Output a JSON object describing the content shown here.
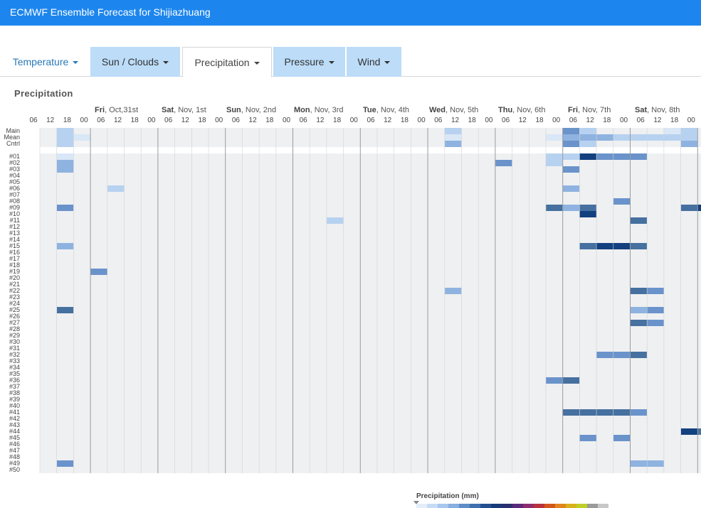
{
  "app": {
    "title": "ECMWF Ensemble Forecast for Shijiazhuang"
  },
  "tabs": [
    {
      "label": "Temperature",
      "active": false
    },
    {
      "label": "Sun / Clouds",
      "active": false
    },
    {
      "label": "Precipitation",
      "active": true
    },
    {
      "label": "Pressure",
      "active": false
    },
    {
      "label": "Wind",
      "active": false
    }
  ],
  "section": {
    "title": "Precipitation"
  },
  "days": [
    {
      "weekday": "Fri",
      "date": ", Oct,31st"
    },
    {
      "weekday": "Sat",
      "date": ", Nov, 1st"
    },
    {
      "weekday": "Sun",
      "date": ", Nov, 2nd"
    },
    {
      "weekday": "Mon",
      "date": ", Nov, 3rd"
    },
    {
      "weekday": "Tue",
      "date": ", Nov, 4th"
    },
    {
      "weekday": "Wed",
      "date": ", Nov, 5th"
    },
    {
      "weekday": "Thu",
      "date": ", Nov, 6th"
    },
    {
      "weekday": "Fri",
      "date": ", Nov, 7th"
    },
    {
      "weekday": "Sat",
      "date": ", Nov, 8th"
    }
  ],
  "hours": [
    "06",
    "12",
    "18",
    "00",
    "06",
    "12",
    "18",
    "00",
    "06",
    "12",
    "18",
    "00",
    "06",
    "12",
    "18",
    "00",
    "06",
    "12",
    "18",
    "00",
    "06",
    "12",
    "18",
    "00",
    "06",
    "12",
    "18",
    "00",
    "06",
    "12",
    "18",
    "00",
    "06",
    "12",
    "18",
    "00",
    "06",
    "12",
    "18",
    "00",
    "00"
  ],
  "summary_rows": [
    "Main",
    "Mean",
    "Cntrl"
  ],
  "members": [
    "#01",
    "#02",
    "#03",
    "#04",
    "#05",
    "#06",
    "#07",
    "#08",
    "#09",
    "#10",
    "#11",
    "#12",
    "#13",
    "#14",
    "#15",
    "#16",
    "#17",
    "#18",
    "#19",
    "#20",
    "#21",
    "#22",
    "#23",
    "#24",
    "#25",
    "#26",
    "#27",
    "#28",
    "#29",
    "#30",
    "#31",
    "#32",
    "#33",
    "#34",
    "#35",
    "#36",
    "#37",
    "#38",
    "#39",
    "#40",
    "#41",
    "#42",
    "#43",
    "#44",
    "#45",
    "#46",
    "#47",
    "#48",
    "#49",
    "#50"
  ],
  "legend": {
    "title": "Precipitation (mm)",
    "colors": [
      "#e4eefa",
      "#c6dcf6",
      "#a7c7ee",
      "#86aedf",
      "#5f8dc7",
      "#3f6fae",
      "#244f8f",
      "#163b78",
      "#2a2f6e",
      "#5a2a7a",
      "#8f2c6e",
      "#b8323c",
      "#d4561d",
      "#e1861d",
      "#d8b21c",
      "#bfcf27",
      "#9a9a9a",
      "#c8c8c8"
    ]
  },
  "colors": {
    "titlebar": "#1d86ee",
    "tab_inactive": "#bcdcf8",
    "precip_scale": [
      "#eff0f2",
      "#d9e7f7",
      "#b7d2f0",
      "#8fb3e0",
      "#6a93cb",
      "#46709f",
      "#13407f"
    ]
  },
  "chart_data": {
    "type": "heatmap",
    "title": "Precipitation",
    "xlabel": "",
    "ylabel": "",
    "x_days": [
      "Fri, Oct,31st",
      "Sat, Nov, 1st",
      "Sun, Nov, 2nd",
      "Mon, Nov, 3rd",
      "Tue, Nov, 4th",
      "Wed, Nov, 5th",
      "Thu, Nov, 6th",
      "Fri, Nov, 7th",
      "Sat, Nov, 8th"
    ],
    "x_hours": [
      "06",
      "12",
      "18",
      "00"
    ],
    "rows": [
      "Main",
      "Mean",
      "Cntrl",
      "#01",
      "#02",
      "#03",
      "#04",
      "#05",
      "#06",
      "#07",
      "#08",
      "#09",
      "#10",
      "#11",
      "#12",
      "#13",
      "#14",
      "#15",
      "#16",
      "#17",
      "#18",
      "#19",
      "#20",
      "#21",
      "#22",
      "#23",
      "#24",
      "#25",
      "#26",
      "#27",
      "#28",
      "#29",
      "#30",
      "#31",
      "#32",
      "#33",
      "#34",
      "#35",
      "#36",
      "#37",
      "#38",
      "#39",
      "#40",
      "#41",
      "#42",
      "#43",
      "#44",
      "#45",
      "#46",
      "#47",
      "#48",
      "#49",
      "#50"
    ],
    "intensity_levels": "0 = none, 1 = very light ... 6 = heavy",
    "cells": [
      {
        "row": "Main",
        "col": 1,
        "v": 2
      },
      {
        "row": "Main",
        "col": 24,
        "v": 2
      },
      {
        "row": "Main",
        "col": 31,
        "v": 4
      },
      {
        "row": "Main",
        "col": 32,
        "v": 2
      },
      {
        "row": "Main",
        "col": 37,
        "v": 1
      },
      {
        "row": "Main",
        "col": 38,
        "v": 2
      },
      {
        "row": "Mean",
        "col": 1,
        "v": 2
      },
      {
        "row": "Mean",
        "col": 2,
        "v": 1
      },
      {
        "row": "Mean",
        "col": 24,
        "v": 1
      },
      {
        "row": "Mean",
        "col": 30,
        "v": 1
      },
      {
        "row": "Mean",
        "col": 31,
        "v": 3
      },
      {
        "row": "Mean",
        "col": 32,
        "v": 3
      },
      {
        "row": "Mean",
        "col": 33,
        "v": 3
      },
      {
        "row": "Mean",
        "col": 34,
        "v": 2
      },
      {
        "row": "Mean",
        "col": 35,
        "v": 2
      },
      {
        "row": "Mean",
        "col": 36,
        "v": 2
      },
      {
        "row": "Mean",
        "col": 37,
        "v": 2
      },
      {
        "row": "Mean",
        "col": 38,
        "v": 2
      },
      {
        "row": "Cntrl",
        "col": 1,
        "v": 2
      },
      {
        "row": "Cntrl",
        "col": 24,
        "v": 3
      },
      {
        "row": "Cntrl",
        "col": 31,
        "v": 4
      },
      {
        "row": "Cntrl",
        "col": 32,
        "v": 2
      },
      {
        "row": "Cntrl",
        "col": 38,
        "v": 3
      },
      {
        "row": "#01",
        "col": 1,
        "v": 1
      },
      {
        "row": "#01",
        "col": 30,
        "v": 2
      },
      {
        "row": "#01",
        "col": 31,
        "v": 2
      },
      {
        "row": "#01",
        "col": 32,
        "v": 6
      },
      {
        "row": "#01",
        "col": 33,
        "v": 4
      },
      {
        "row": "#01",
        "col": 34,
        "v": 4
      },
      {
        "row": "#01",
        "col": 35,
        "v": 4
      },
      {
        "row": "#02",
        "col": 1,
        "v": 3
      },
      {
        "row": "#02",
        "col": 27,
        "v": 4
      },
      {
        "row": "#02",
        "col": 30,
        "v": 2
      },
      {
        "row": "#03",
        "col": 1,
        "v": 3
      },
      {
        "row": "#03",
        "col": 31,
        "v": 4
      },
      {
        "row": "#06",
        "col": 4,
        "v": 2
      },
      {
        "row": "#06",
        "col": 31,
        "v": 3
      },
      {
        "row": "#08",
        "col": 34,
        "v": 4
      },
      {
        "row": "#09",
        "col": 1,
        "v": 4
      },
      {
        "row": "#09",
        "col": 30,
        "v": 5
      },
      {
        "row": "#09",
        "col": 31,
        "v": 3
      },
      {
        "row": "#09",
        "col": 32,
        "v": 5
      },
      {
        "row": "#09",
        "col": 38,
        "v": 5
      },
      {
        "row": "#09",
        "col": 39,
        "v": 6
      },
      {
        "row": "#10",
        "col": 32,
        "v": 6
      },
      {
        "row": "#11",
        "col": 17,
        "v": 2
      },
      {
        "row": "#11",
        "col": 35,
        "v": 5
      },
      {
        "row": "#15",
        "col": 1,
        "v": 3
      },
      {
        "row": "#15",
        "col": 32,
        "v": 5
      },
      {
        "row": "#15",
        "col": 33,
        "v": 6
      },
      {
        "row": "#15",
        "col": 34,
        "v": 6
      },
      {
        "row": "#15",
        "col": 35,
        "v": 5
      },
      {
        "row": "#19",
        "col": 3,
        "v": 4
      },
      {
        "row": "#22",
        "col": 24,
        "v": 3
      },
      {
        "row": "#22",
        "col": 35,
        "v": 5
      },
      {
        "row": "#22",
        "col": 36,
        "v": 4
      },
      {
        "row": "#25",
        "col": 1,
        "v": 5
      },
      {
        "row": "#25",
        "col": 35,
        "v": 3
      },
      {
        "row": "#25",
        "col": 36,
        "v": 4
      },
      {
        "row": "#27",
        "col": 35,
        "v": 5
      },
      {
        "row": "#27",
        "col": 36,
        "v": 4
      },
      {
        "row": "#32",
        "col": 33,
        "v": 4
      },
      {
        "row": "#32",
        "col": 34,
        "v": 4
      },
      {
        "row": "#32",
        "col": 35,
        "v": 5
      },
      {
        "row": "#36",
        "col": 30,
        "v": 4
      },
      {
        "row": "#36",
        "col": 31,
        "v": 5
      },
      {
        "row": "#41",
        "col": 31,
        "v": 5
      },
      {
        "row": "#41",
        "col": 32,
        "v": 5
      },
      {
        "row": "#41",
        "col": 33,
        "v": 5
      },
      {
        "row": "#41",
        "col": 34,
        "v": 5
      },
      {
        "row": "#41",
        "col": 35,
        "v": 4
      },
      {
        "row": "#44",
        "col": 38,
        "v": 6
      },
      {
        "row": "#44",
        "col": 39,
        "v": 5
      },
      {
        "row": "#45",
        "col": 32,
        "v": 4
      },
      {
        "row": "#45",
        "col": 34,
        "v": 4
      },
      {
        "row": "#49",
        "col": 1,
        "v": 4
      },
      {
        "row": "#49",
        "col": 35,
        "v": 3
      },
      {
        "row": "#49",
        "col": 36,
        "v": 3
      }
    ]
  }
}
